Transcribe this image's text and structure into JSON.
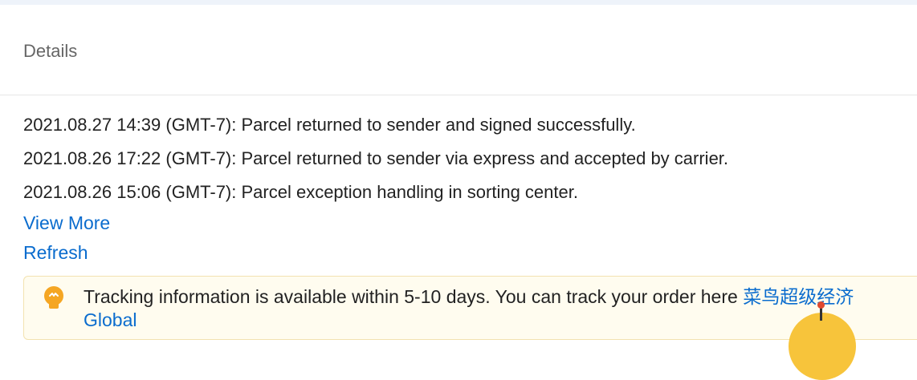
{
  "header": {
    "title": "Details"
  },
  "events": [
    {
      "text": "2021.08.27 14:39 (GMT-7): Parcel returned to sender and signed successfully."
    },
    {
      "text": "2021.08.26 17:22 (GMT-7): Parcel returned to sender via express and accepted by carrier."
    },
    {
      "text": "2021.08.26 15:06 (GMT-7): Parcel exception handling in sorting center."
    }
  ],
  "links": {
    "view_more": "View More",
    "refresh": "Refresh"
  },
  "notice": {
    "icon": "lightbulb-icon",
    "text": "Tracking information is available within 5-10 days. You can track your order here ",
    "link_text": "菜鸟超级经济Global"
  },
  "colors": {
    "link": "#0a6cce",
    "notice_bg": "#fffcef",
    "bulb": "#f5a623"
  }
}
